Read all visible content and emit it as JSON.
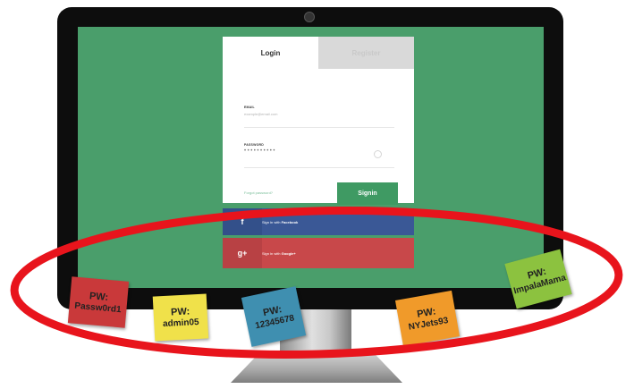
{
  "login_card": {
    "tab_login": "Login",
    "tab_register": "Register",
    "email_label": "EMAIL",
    "email_placeholder": "example@email.com",
    "password_label": "PASSWORD",
    "password_value": "••••••••••",
    "forgot_link": "Forgot password?",
    "signin_label": "Signin"
  },
  "social": {
    "facebook_icon_glyph": "f",
    "facebook_label_prefix": "Sign in with ",
    "facebook_label_brand": "Facebook",
    "google_icon_glyph": "g+",
    "google_label_prefix": "Sign in with ",
    "google_label_brand": "Google+"
  },
  "notes": [
    {
      "pw": "PW:",
      "value": "Passw0rd1",
      "color": "#c9393a"
    },
    {
      "pw": "PW:",
      "value": "admin05",
      "color": "#f0e14a"
    },
    {
      "pw": "PW:",
      "value": "12345678",
      "color": "#3f8fb0"
    },
    {
      "pw": "PW:",
      "value": "NYJets93",
      "color": "#f09a2a"
    },
    {
      "pw": "PW:",
      "value": "ImpalaMama",
      "color": "#8cc23f"
    }
  ],
  "colors": {
    "screen": "#4a9e6b",
    "signin_button": "#3f9a63",
    "facebook": "#3a5896",
    "google": "#c8484a",
    "ring": "#e8141c"
  }
}
